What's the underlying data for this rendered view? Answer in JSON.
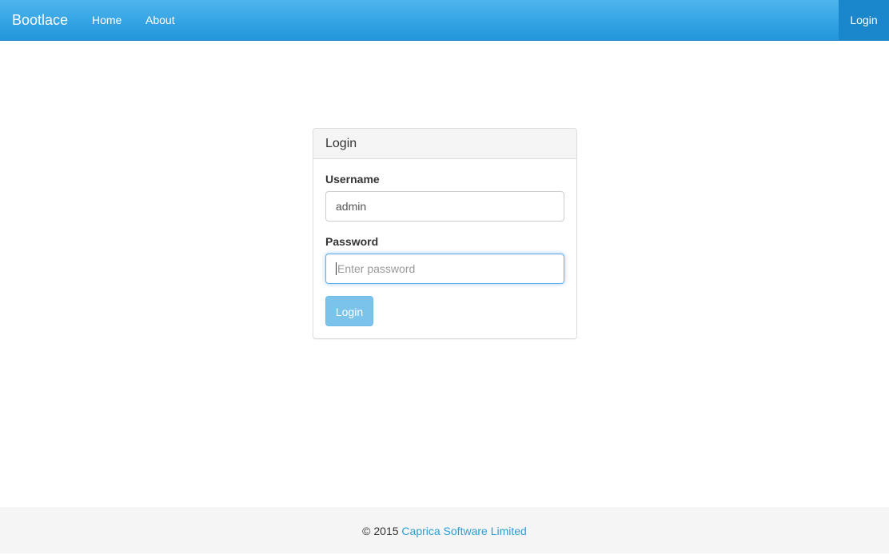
{
  "navbar": {
    "brand": "Bootlace",
    "links": [
      {
        "label": "Home"
      },
      {
        "label": "About"
      }
    ],
    "login_label": "Login"
  },
  "login_panel": {
    "title": "Login",
    "username": {
      "label": "Username",
      "value": "admin"
    },
    "password": {
      "label": "Password",
      "placeholder": "Enter password",
      "value": ""
    },
    "submit_label": "Login"
  },
  "footer": {
    "copyright": "© 2015",
    "company": "Caprica Software Limited"
  },
  "colors": {
    "navbar_top": "#4eb5ee",
    "navbar_bottom": "#2196db",
    "accent": "#2a9fd6",
    "button_disabled": "#7cc3ec"
  }
}
